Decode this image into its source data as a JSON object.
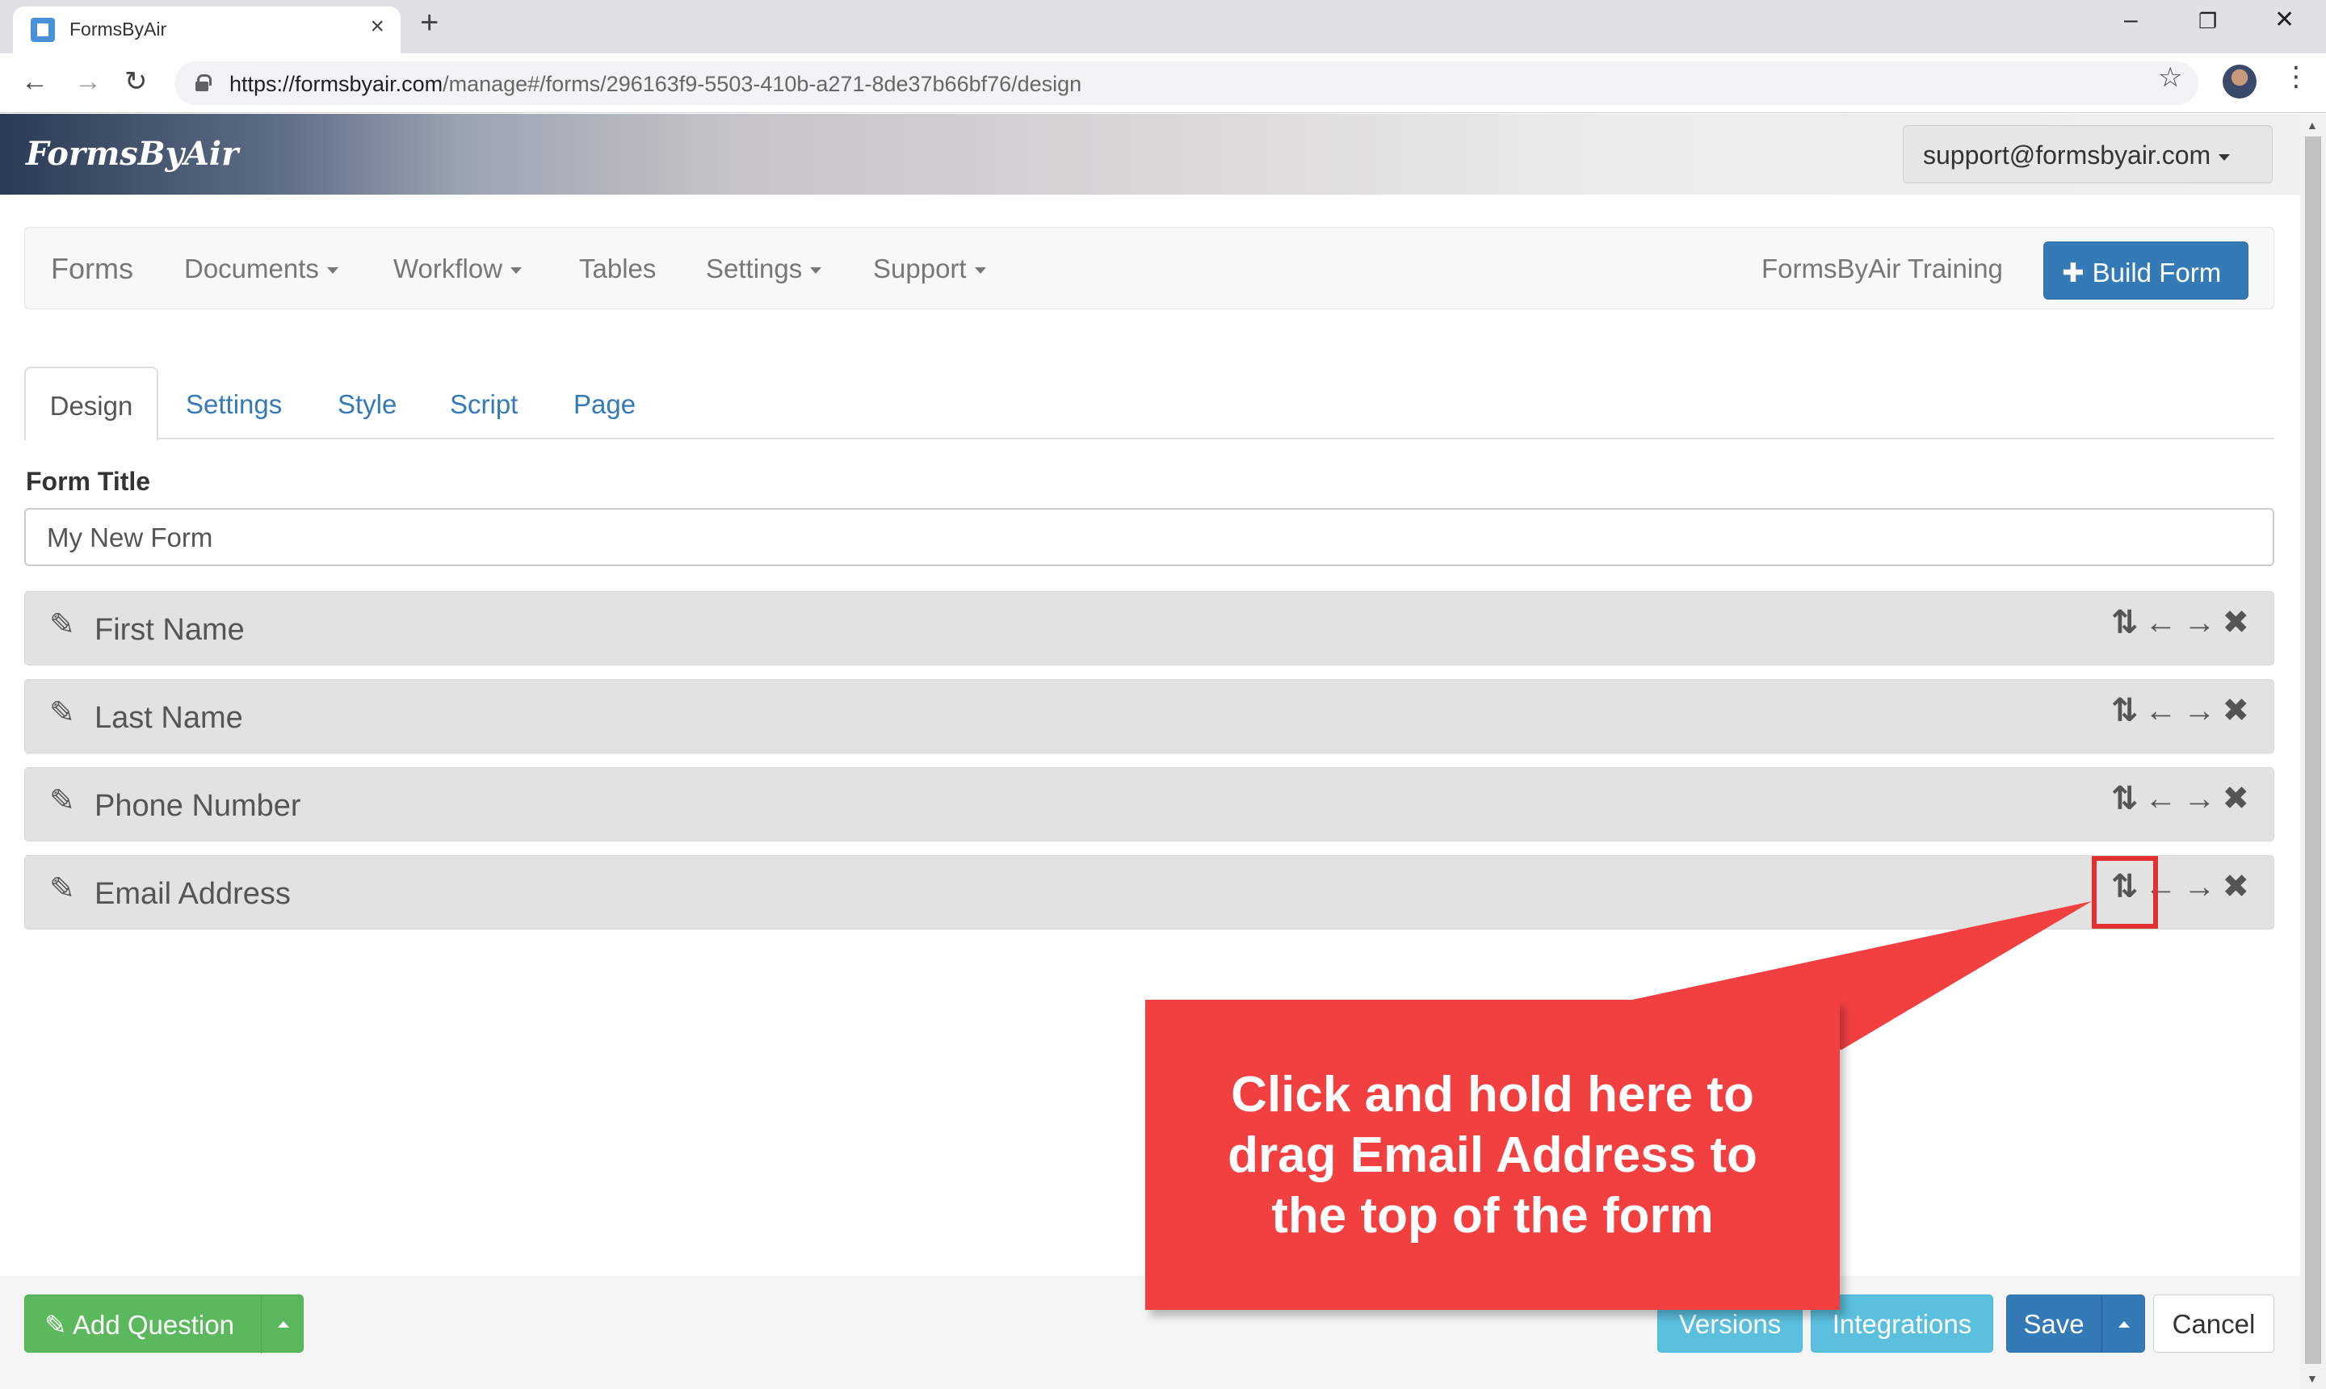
{
  "browser": {
    "tab_title": "FormsByAir",
    "url_host": "https://formsbyair.com",
    "url_path": "/manage#/forms/296163f9-5503-410b-a271-8de37b66bf76/design"
  },
  "header": {
    "logo": "FormsByAir",
    "account": "support@formsbyair.com"
  },
  "navbar": {
    "brand": "Forms",
    "items": [
      "Documents",
      "Workflow",
      "Tables",
      "Settings",
      "Support"
    ],
    "org": "FormsByAir Training",
    "build_button": "Build Form"
  },
  "form_tabs": [
    "Design",
    "Settings",
    "Style",
    "Script",
    "Page"
  ],
  "active_tab": "Design",
  "form": {
    "title_label": "Form Title",
    "title_value": "My New Form",
    "questions": [
      "First Name",
      "Last Name",
      "Phone Number",
      "Email Address"
    ]
  },
  "callout": {
    "lines": [
      "Click and hold here to",
      "drag Email Address to",
      "the top of the form"
    ],
    "color": "#f24040"
  },
  "bottom": {
    "add_question": "Add Question",
    "versions": "Versions",
    "integrations": "Integrations",
    "save": "Save",
    "cancel": "Cancel"
  },
  "icons": {
    "question_edit": "pencil-icon",
    "question_actions": [
      "move-vertical-icon",
      "arrow-left-icon",
      "arrow-right-icon",
      "remove-icon"
    ]
  },
  "colors": {
    "primary": "#337ab7",
    "success": "#5cb85c",
    "info": "#5bc0de",
    "highlight": "#e03030"
  }
}
